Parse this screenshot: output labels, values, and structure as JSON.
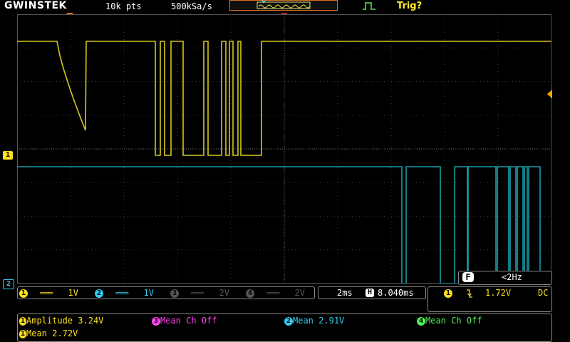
{
  "header": {
    "brand": "GWINSTEK",
    "record_length": "10k pts",
    "sample_rate": "500kSa/s",
    "trigger_status": "Trig?"
  },
  "markers": {
    "ch1_label": "1",
    "ch2_label": "2"
  },
  "channels": [
    {
      "id": "1",
      "coupling_icon": "dc-coupling-icon",
      "scale": "1V",
      "color": "#ffe020",
      "active": true
    },
    {
      "id": "2",
      "coupling_icon": "dc-coupling-icon",
      "scale": "1V",
      "color": "#33ccee",
      "active": true
    },
    {
      "id": "3",
      "coupling_icon": "dc-coupling-icon",
      "scale": "2V",
      "color": "#666666",
      "active": false
    },
    {
      "id": "4",
      "coupling_icon": "dc-coupling-icon",
      "scale": "2V",
      "color": "#666666",
      "active": false
    }
  ],
  "timebase": {
    "scale": "2ms",
    "position_icon": "H",
    "position": "8.040ms"
  },
  "frequency": {
    "badge": "F",
    "value": "<2Hz"
  },
  "trigger": {
    "source": "1",
    "slope_icon": "falling-edge-icon",
    "level": "1.72V",
    "coupling": "DC"
  },
  "measurements": {
    "ch1_amplitude": {
      "channel": "1",
      "label": "Amplitude",
      "value": "3.24V"
    },
    "ch3_mean": {
      "channel": "3",
      "label": "Mean",
      "value": "Ch Off"
    },
    "ch2_mean": {
      "channel": "2",
      "label": "Mean",
      "value": "2.91V"
    },
    "ch4_mean": {
      "channel": "4",
      "label": "Mean",
      "value": "Ch Off"
    },
    "ch1_mean": {
      "channel": "1",
      "label": "Mean",
      "value": "2.72V"
    }
  }
}
